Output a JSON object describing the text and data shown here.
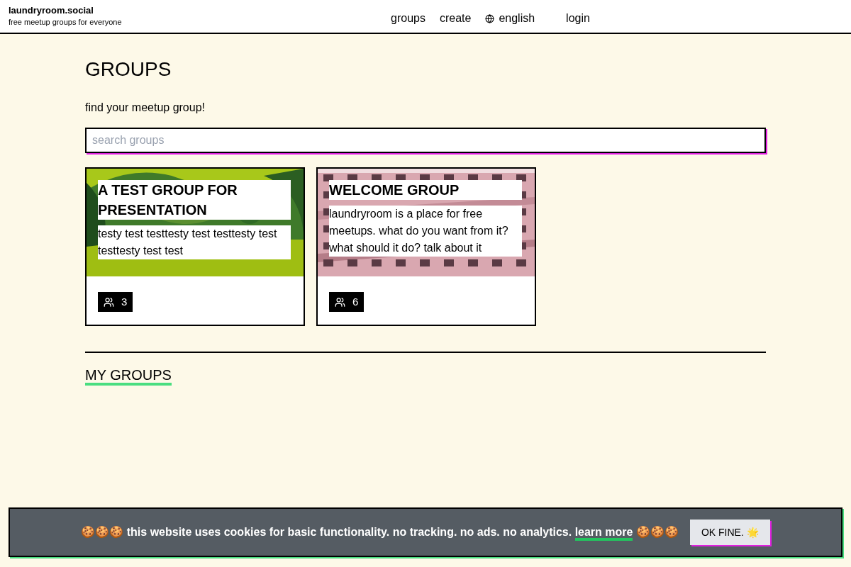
{
  "header": {
    "site_name": "laundryroom.social",
    "tagline": "free meetup groups for everyone",
    "nav": [
      {
        "kind": "link",
        "label": "groups"
      },
      {
        "kind": "link",
        "label": "create"
      },
      {
        "kind": "language",
        "label": "english"
      },
      {
        "kind": "link",
        "label": "login"
      }
    ]
  },
  "page": {
    "title": "GROUPS",
    "intro": "find your meetup group!",
    "search": {
      "placeholder": "search groups"
    }
  },
  "groups": [
    {
      "title": "A TEST GROUP FOR PRESENTATION",
      "description": "testy test testtesty test testtesty test testtesty test test",
      "members": "3"
    },
    {
      "title": "WELCOME GROUP",
      "description": "laundryroom is a place for free meetups. what do you want from it? what should it do? talk about it",
      "members": "6"
    }
  ],
  "my_groups": {
    "title": "MY GROUPS"
  },
  "cookie_banner": {
    "text_before": "🍪🍪🍪 this website uses cookies for basic functionality. no tracking. no ads. no analytics.",
    "link": "learn more",
    "text_after": "🍪🍪🍪",
    "button": "OK FINE. 🌟"
  }
}
